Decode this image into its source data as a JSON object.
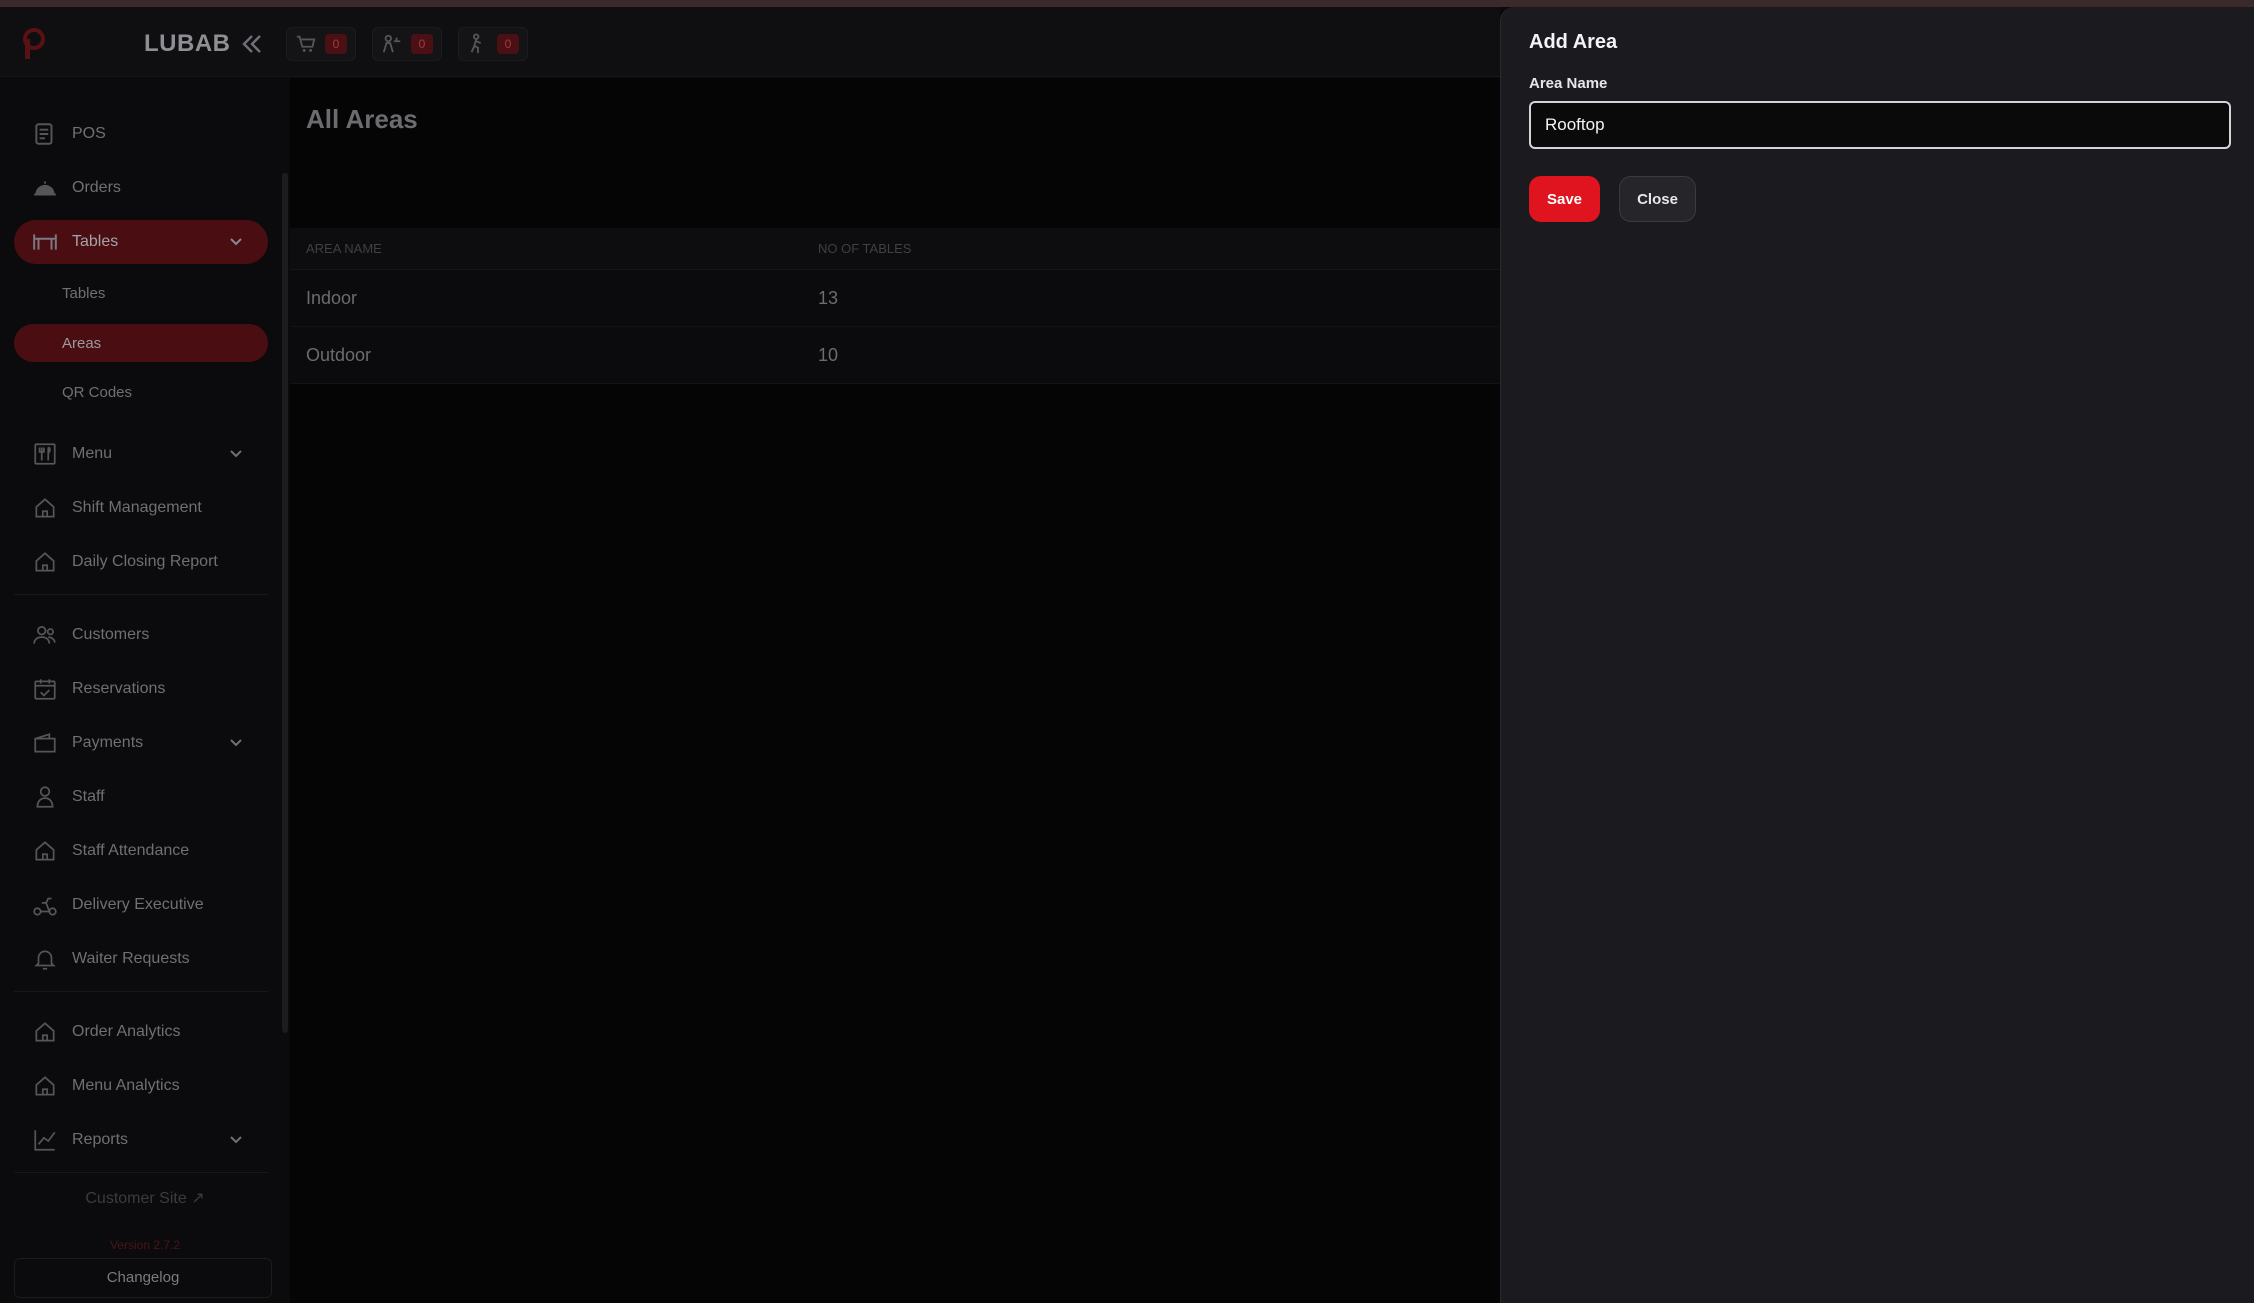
{
  "header": {
    "logo_text": "",
    "brand": "LUBAB",
    "badges": [
      {
        "icon": "cart-icon",
        "count": "0"
      },
      {
        "icon": "waiter-icon",
        "count": "0"
      },
      {
        "icon": "delivery-icon",
        "count": "0"
      }
    ]
  },
  "sidebar": {
    "items": {
      "pos": "POS",
      "orders": "Orders",
      "tables": "Tables",
      "tables_sub": "Tables",
      "areas": "Areas",
      "qr_codes": "QR Codes",
      "menu": "Menu",
      "shift_management": "Shift Management",
      "daily_closing_report": "Daily Closing Report",
      "customers": "Customers",
      "reservations": "Reservations",
      "payments": "Payments",
      "staff": "Staff",
      "staff_attendance": "Staff Attendance",
      "delivery_executive": "Delivery Executive",
      "waiter_requests": "Waiter Requests",
      "order_analytics": "Order Analytics",
      "menu_analytics": "Menu Analytics",
      "reports": "Reports"
    },
    "customer_site": "Customer Site",
    "version": "Version 2.7.2",
    "changelog": "Changelog"
  },
  "main": {
    "title": "All Areas",
    "columns": [
      "AREA NAME",
      "NO OF TABLES"
    ],
    "rows": [
      {
        "name": "Indoor",
        "tables": "13"
      },
      {
        "name": "Outdoor",
        "tables": "10"
      }
    ]
  },
  "drawer": {
    "title": "Add Area",
    "field_label": "Area Name",
    "field_value": "Rooftop",
    "save": "Save",
    "close": "Close"
  },
  "colors": {
    "accent": "#e0141f",
    "active_nav": "#4a0e12",
    "drawer_bg": "#1b1b1f"
  }
}
